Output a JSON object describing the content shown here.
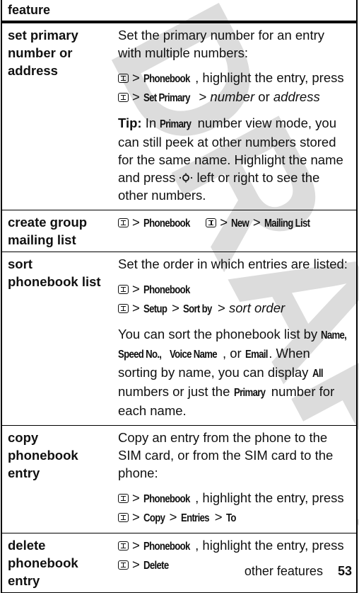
{
  "watermark": "DRAFT",
  "table": {
    "header": "feature",
    "rows": [
      {
        "feature": "set primary number or address",
        "intro": "Set the primary number for an entry with multiple numbers:",
        "path1_key": "Phonebook",
        "path1_text": ", highlight the entry, press",
        "path2_key": "Set Primary",
        "path2_opt1": "number",
        "path2_or": "or",
        "path2_opt2": "address",
        "tip_label": "Tip:",
        "tip_pre": "In",
        "tip_key": "Primary",
        "tip_text1": "number view mode, you can still peek at other numbers stored for the same name. Highlight the name and press",
        "tip_icon": "nav-key-icon",
        "tip_text2": "left or right to see the other numbers."
      },
      {
        "feature": "create group mailing list",
        "key1": "Phonebook",
        "key2": "New",
        "key3": "Mailing List"
      },
      {
        "feature": "sort phonebook list",
        "intro": "Set the order in which entries are listed:",
        "key1": "Phonebook",
        "key2": "Setup",
        "key3": "Sort by",
        "opt": "sort order",
        "note_pre": "You can sort the phonebook list by",
        "opt_name": "Name,",
        "opt_speed": "Speed No.,",
        "opt_voice": "Voice Name",
        "note_or": ", or",
        "opt_email": "Email",
        "note_mid": ". When sorting by name, you can display",
        "opt_all": "All",
        "note_mid2": "numbers or just the",
        "opt_primary": "Primary",
        "note_end": "number for each name."
      },
      {
        "feature": "copy phonebook entry",
        "intro": "Copy an entry from the phone to the SIM card, or from the SIM card to the phone:",
        "key1": "Phonebook",
        "path1_text": ", highlight the entry, press",
        "key2": "Copy",
        "key3": "Entries",
        "key4": "To"
      },
      {
        "feature": "delete phonebook entry",
        "key1": "Phonebook",
        "path1_text": ", highlight the entry, press",
        "key2": "Delete"
      }
    ],
    "separator": ">",
    "menu_icon": "menu-key-icon"
  },
  "footer": {
    "section": "other features",
    "page": "53"
  }
}
